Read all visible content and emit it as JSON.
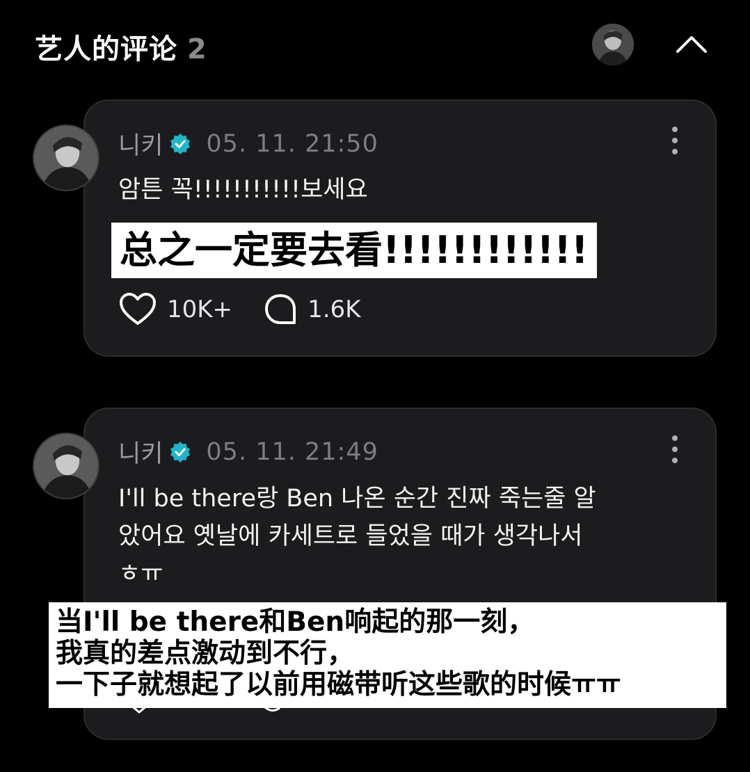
{
  "header": {
    "title": "艺人的评论",
    "count": "2"
  },
  "comments": [
    {
      "username": "니키",
      "timestamp": "05. 11. 21:50",
      "text": "암튼 꼭!!!!!!!!!!!보세요",
      "subtitle": "总之一定要去看!!!!!!!!!!!!",
      "likes": "10K+",
      "replies": "1.6K"
    },
    {
      "username": "니키",
      "timestamp": "05. 11. 21:49",
      "text_lines": [
        "I'll be there랑 Ben 나온 순간 진짜 죽는줄 알",
        "았어요 옛날에 카세트로 들었을 때가 생각나서",
        "ㅎㅠ"
      ],
      "subtitle_lines": [
        "当I'll be there和Ben响起的那一刻，",
        "我真的差点激动到不行，",
        "一下子就想起了以前用磁带听这些歌的时候ㅠㅠ"
      ]
    }
  ],
  "colors": {
    "background": "#000000",
    "card": "#1c1c1e",
    "verified_badge": "#22b5c9",
    "muted_text": "#8e8e93"
  },
  "icons": [
    "verified-badge-icon",
    "more-vertical-icon",
    "heart-icon",
    "comment-bubble-icon",
    "chevron-up-icon"
  ]
}
